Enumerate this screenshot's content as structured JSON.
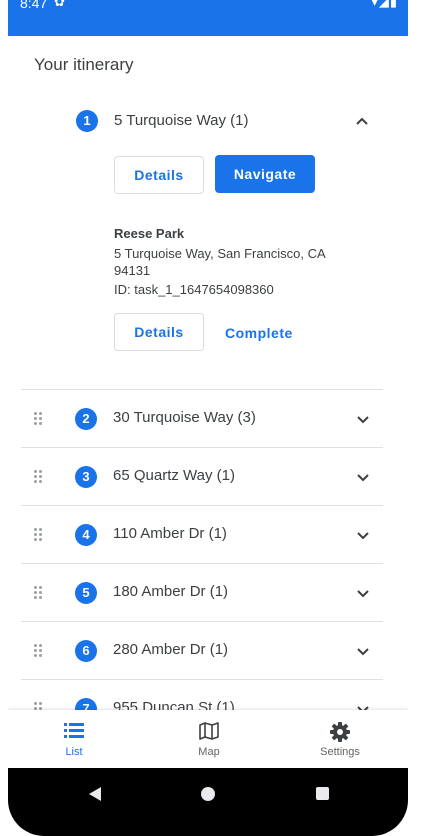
{
  "statusbar": {
    "time": "8:47",
    "right_icons": "▾◢▮"
  },
  "heading": "Your itinerary",
  "expanded_stop": {
    "number": "1",
    "title": "5 Turquoise Way (1)",
    "details_label": "Details",
    "navigate_label": "Navigate",
    "task": {
      "name": "Reese Park",
      "address": "5 Turquoise Way, San Francisco, CA 94131",
      "id": "ID: task_1_1647654098360",
      "details_label": "Details",
      "complete_label": "Complete"
    }
  },
  "stops": [
    {
      "number": "2",
      "title": "30 Turquoise Way (3)"
    },
    {
      "number": "3",
      "title": "65 Quartz Way (1)"
    },
    {
      "number": "4",
      "title": "110 Amber Dr (1)"
    },
    {
      "number": "5",
      "title": "180 Amber Dr (1)"
    },
    {
      "number": "6",
      "title": "280 Amber Dr (1)"
    },
    {
      "number": "7",
      "title": "955 Duncan St (1)"
    }
  ],
  "bottom_nav": [
    {
      "label": "List",
      "icon": "list-icon",
      "active": true
    },
    {
      "label": "Map",
      "icon": "map-icon",
      "active": false
    },
    {
      "label": "Settings",
      "icon": "gear-icon",
      "active": false
    }
  ],
  "colors": {
    "accent": "#1a73e8",
    "text": "#3c4043",
    "muted": "#5f6368"
  }
}
